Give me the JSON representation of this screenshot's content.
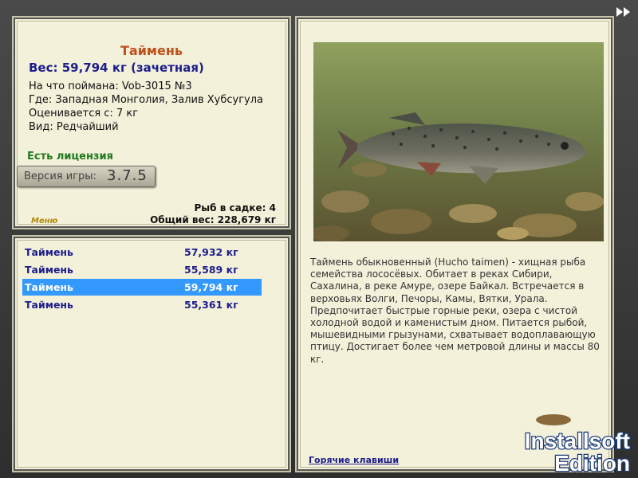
{
  "fish": {
    "name": "Таймень",
    "weight_line": "Вес: 59,794 кг (зачетная)",
    "caught_with": "На что поймана: Vob-3015 №3",
    "location": "Где: Западная Монголия, Залив Хубсугула",
    "valued_from": "Оценивается с: 7 кг",
    "kind": "Вид: Редчайший"
  },
  "license": "Есть лицензия",
  "version": {
    "label": "Версия игры:",
    "value": "3.7.5"
  },
  "menu_label": "Меню",
  "keepnet": {
    "count_line": "Рыб в садке: 4",
    "total_line": "Общий вес: 228,679 кг"
  },
  "catch_list": [
    {
      "name": "Таймень",
      "weight": "57,932 кг"
    },
    {
      "name": "Таймень",
      "weight": "55,589 кг"
    },
    {
      "name": "Таймень",
      "weight": "59,794 кг"
    },
    {
      "name": "Таймень",
      "weight": "55,361 кг"
    }
  ],
  "selected_index": 2,
  "description": "Таймень обыкновенный (Hucho taimen) - хищная рыба семейства лососёвых. Обитает в реках Сибири, Сахалина, в реке Амуре, озере Байкал. Встречается в верховьях Волги, Печоры, Камы, Вятки, Урала. Предпочитает быстрые горные реки, озера с чистой холодной водой и каменистым дном. Питается рыбой, мышевидными грызунами, схватывает водоплавающую птицу. Достигает более чем метровой длины и массы 80 кг.",
  "hotkeys_link": "Горячие клавиши",
  "watermark": {
    "line1": "Installsoft",
    "line2": "Edition"
  },
  "icons": {
    "fast_forward": "fast-forward-icon"
  },
  "colors": {
    "title": "#c0501a",
    "accent_blue": "#1d1d8c",
    "license_green": "#1e7a1e",
    "selection": "#3399ff"
  }
}
